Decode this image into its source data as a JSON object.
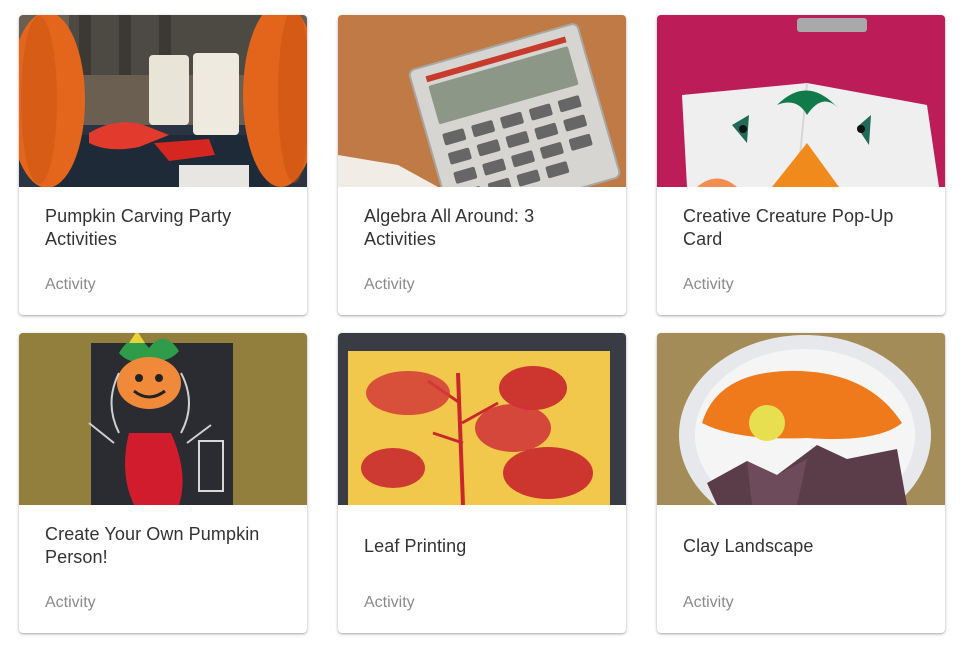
{
  "cards": [
    {
      "title": "Pumpkin Carving Party Activities",
      "type": "Activity",
      "image_icon": "pumpkin-carving-photo"
    },
    {
      "title": "Algebra All Around: 3 Activities",
      "type": "Activity",
      "image_icon": "calculator-photo"
    },
    {
      "title": "Creative Creature Pop-Up Card",
      "type": "Activity",
      "image_icon": "pop-up-card-photo"
    },
    {
      "title": "Create Your Own Pumpkin Person!",
      "type": "Activity",
      "image_icon": "pumpkin-person-photo"
    },
    {
      "title": "Leaf Printing",
      "type": "Activity",
      "image_icon": "leaf-print-photo"
    },
    {
      "title": "Clay Landscape",
      "type": "Activity",
      "image_icon": "clay-landscape-photo"
    }
  ]
}
